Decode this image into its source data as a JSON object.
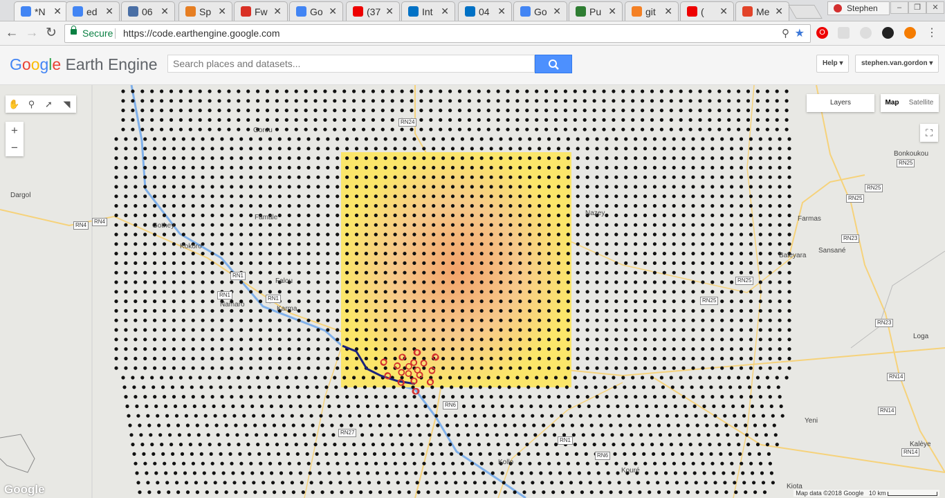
{
  "browser": {
    "tabs": [
      {
        "label": "*N",
        "icon": "gear-icon",
        "color": "#4285f4"
      },
      {
        "label": "ed",
        "icon": "google-icon",
        "color": "#4285f4"
      },
      {
        "label": "06",
        "icon": "goodreads-icon",
        "color": "#4a6fa5"
      },
      {
        "label": "Sp",
        "icon": "etsy-icon",
        "color": "#e67e22"
      },
      {
        "label": "Fw",
        "icon": "gmail-icon",
        "color": "#d93025"
      },
      {
        "label": "Go",
        "icon": "google-icon",
        "color": "#4285f4"
      },
      {
        "label": "(37",
        "icon": "youtube-icon",
        "color": "#e00"
      },
      {
        "label": "Int",
        "icon": "intel-icon",
        "color": "#0071c5"
      },
      {
        "label": "04",
        "icon": "intel-icon",
        "color": "#0071c5"
      },
      {
        "label": "Go",
        "icon": "google-icon",
        "color": "#4285f4"
      },
      {
        "label": "Pu",
        "icon": "puzzle-icon",
        "color": "#2e7d32"
      },
      {
        "label": "git",
        "icon": "stackoverflow-icon",
        "color": "#f48024"
      },
      {
        "label": "(",
        "icon": "youtube-icon",
        "color": "#e00"
      },
      {
        "label": "Me",
        "icon": "gitlab-icon",
        "color": "#e24329"
      }
    ],
    "profile_name": "Stephen",
    "address": {
      "secure_label": "Secure",
      "url": "https://code.earthengine.google.com"
    }
  },
  "app": {
    "logo_google": [
      "G",
      "o",
      "o",
      "g",
      "l",
      "e"
    ],
    "logo_rest": "Earth Engine",
    "search_placeholder": "Search places and datasets...",
    "help_label": "Help",
    "user_label": "stephen.van.gordon"
  },
  "map": {
    "layers_label": "Layers",
    "map_type_map": "Map",
    "map_type_satellite": "Satellite",
    "zoom_in": "+",
    "zoom_out": "−",
    "places": [
      {
        "name": "Dargol"
      },
      {
        "name": "Karma"
      },
      {
        "name": "Gothey"
      },
      {
        "name": "Kollo"
      },
      {
        "name": "Bonkoukou"
      },
      {
        "name": "Farmas"
      },
      {
        "name": "Sansané"
      },
      {
        "name": "Baleyara"
      },
      {
        "name": "Loga"
      },
      {
        "name": "Yeni"
      },
      {
        "name": "Kalèye"
      },
      {
        "name": "Kiota"
      },
      {
        "name": "Kouré"
      },
      {
        "name": "Namaro"
      },
      {
        "name": "Famale"
      },
      {
        "name": "Nazey"
      },
      {
        "name": "Kokoro"
      },
      {
        "name": "Falou"
      },
      {
        "name": "Gorou"
      }
    ],
    "roads": [
      {
        "name": "RN4"
      },
      {
        "name": "RN4"
      },
      {
        "name": "RN1"
      },
      {
        "name": "RN1"
      },
      {
        "name": "RN24"
      },
      {
        "name": "RN25"
      },
      {
        "name": "RN25"
      },
      {
        "name": "RN25"
      },
      {
        "name": "RN23"
      },
      {
        "name": "RN23"
      },
      {
        "name": "RN14"
      },
      {
        "name": "RN14"
      },
      {
        "name": "RN14"
      },
      {
        "name": "RN25"
      },
      {
        "name": "RN25"
      },
      {
        "name": "RN1"
      },
      {
        "name": "RN6"
      },
      {
        "name": "RN1"
      },
      {
        "name": "RN6"
      },
      {
        "name": "RN27"
      }
    ],
    "attribution": "Map data ©2018 Google",
    "scale_label": "10 km",
    "google_logo": "Google"
  }
}
